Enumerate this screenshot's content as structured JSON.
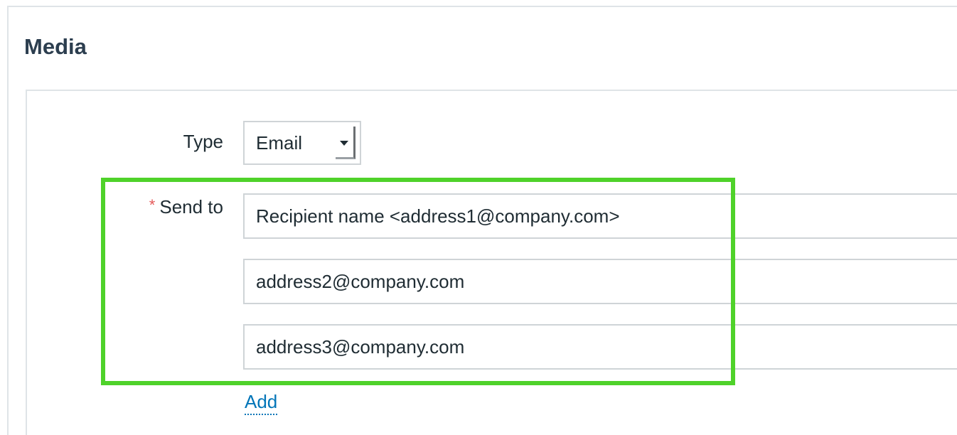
{
  "section": {
    "title": "Media"
  },
  "form": {
    "type_label": "Type",
    "type_value": "Email",
    "sendto_label": "Send to",
    "required_marker": "*",
    "sendto_values": [
      "Recipient name <address1@company.com>",
      "address2@company.com",
      "address3@company.com"
    ],
    "add_label": "Add"
  },
  "colors": {
    "highlight": "#4fd22a",
    "link": "#0275b8",
    "required": "#e45959"
  }
}
